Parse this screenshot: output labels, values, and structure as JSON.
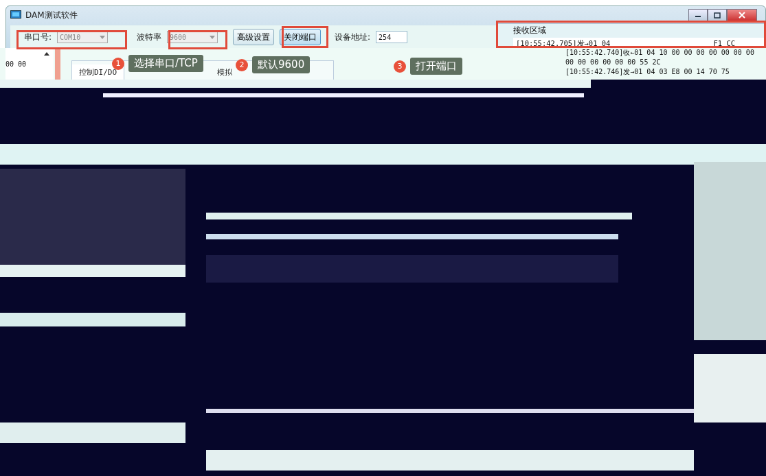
{
  "window": {
    "title": "DAM测试软件"
  },
  "toolbar": {
    "port_label": "串口号:",
    "port_value": "COM10",
    "baud_label": "波特率",
    "baud_value": "9600",
    "buttons": [
      "高级设置",
      "关闭端口"
    ],
    "address_label": "设备地址:",
    "address_value": "254"
  },
  "receive": {
    "title": "接收区域",
    "lines": [
      "[10:55:42.705]发→01 04",
      "F1 CC"
    ]
  },
  "left_panel": {
    "text": "00 00"
  },
  "tabs": [
    {
      "label": "控制DI/DO",
      "selected": true
    },
    {
      "label": "模拟",
      "selected": false
    }
  ],
  "shifted_log": [
    "[10:55:42.740]收←01 04 10 00 00 00 00 00 00 00",
    "00 00 00 00 00 00 55 2C",
    "[10:55:42.746]发→01 04 03 E8 00 14 70 75"
  ],
  "callouts": [
    {
      "number": "1",
      "text": "选择串口/TCP"
    },
    {
      "number": "2",
      "text": "默认9600"
    },
    {
      "number": "3",
      "text": "打开端口"
    }
  ]
}
